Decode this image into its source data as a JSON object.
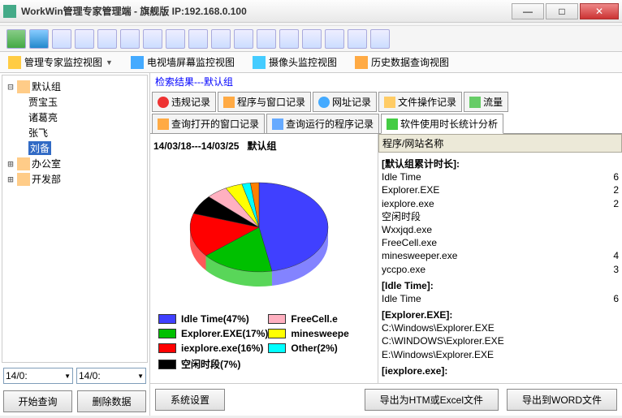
{
  "window": {
    "title": "WorkWin管理专家管理端 - 旗舰版 IP:192.168.0.100"
  },
  "viewtabs": {
    "monitor": "管理专家监控视图",
    "tvwall": "电视墙屏幕监控视图",
    "camera": "摄像头监控视图",
    "history": "历史数据查询视图"
  },
  "tree": {
    "root": "默认组",
    "users": [
      "贾宝玉",
      "诸葛亮",
      "张飞",
      "刘备"
    ],
    "office": "办公室",
    "dev": "开发部"
  },
  "dates": {
    "from": "14/0:",
    "to": "14/0:"
  },
  "buttons": {
    "query": "开始查询",
    "delete": "删除数据",
    "system": "系统设置",
    "export_htm": "导出为HTM或Excel文件",
    "export_word": "导出到WORD文件"
  },
  "search_result": "检索结果---默认组",
  "record_tabs": {
    "violation": "违规记录",
    "program_window": "程序与窗口记录",
    "url": "网址记录",
    "file_op": "文件操作记录",
    "flow": "流量",
    "open_window": "查询打开的窗口记录",
    "running_program": "查询运行的程序记录",
    "usage_stats": "软件使用时长统计分析"
  },
  "chart": {
    "title_range": "14/03/18---14/03/25",
    "title_group": "默认组",
    "legend_left": [
      {
        "label": "Idle Time(47%)",
        "color": "#4040ff"
      },
      {
        "label": "Explorer.EXE(17%)",
        "color": "#00c000"
      },
      {
        "label": "iexplore.exe(16%)",
        "color": "#ff0000"
      },
      {
        "label": "空闲时段(7%)",
        "color": "#000000"
      }
    ],
    "legend_right": [
      {
        "label": "FreeCell.e",
        "color": "#ffb0c0"
      },
      {
        "label": "minesweepe",
        "color": "#ffff00"
      },
      {
        "label": "Other(2%)",
        "color": "#00ffff"
      }
    ]
  },
  "chart_data": {
    "type": "pie",
    "title": "14/03/18---14/03/25 默认组",
    "series": [
      {
        "name": "Idle Time",
        "value": 47,
        "color": "#4040ff"
      },
      {
        "name": "Explorer.EXE",
        "value": 17,
        "color": "#00c000"
      },
      {
        "name": "iexplore.exe",
        "value": 16,
        "color": "#ff0000"
      },
      {
        "name": "空闲时段",
        "value": 7,
        "color": "#000000"
      },
      {
        "name": "FreeCell.exe",
        "value": 5,
        "color": "#ffb0c0"
      },
      {
        "name": "minesweeper.exe",
        "value": 4,
        "color": "#ffff00"
      },
      {
        "name": "Other",
        "value": 2,
        "color": "#00ffff"
      },
      {
        "name": "yccpo.exe",
        "value": 2,
        "color": "#ff8000"
      }
    ]
  },
  "data_list": {
    "header": "程序/网站名称",
    "groups": [
      {
        "title": "[默认组累计时长]:",
        "rows": [
          {
            "name": "Idle Time",
            "val": "6"
          },
          {
            "name": "Explorer.EXE",
            "val": "2"
          },
          {
            "name": "iexplore.exe",
            "val": "2"
          },
          {
            "name": "空闲时段",
            "val": ""
          },
          {
            "name": "Wxxjqd.exe",
            "val": ""
          },
          {
            "name": "FreeCell.exe",
            "val": ""
          },
          {
            "name": "minesweeper.exe",
            "val": "4"
          },
          {
            "name": "yccpo.exe",
            "val": "3"
          }
        ]
      },
      {
        "title": "[Idle Time]:",
        "rows": [
          {
            "name": "Idle Time",
            "val": "6"
          }
        ]
      },
      {
        "title": "[Explorer.EXE]:",
        "rows": [
          {
            "name": "C:\\Windows\\Explorer.EXE",
            "val": ""
          },
          {
            "name": "C:\\WINDOWS\\Explorer.EXE",
            "val": ""
          },
          {
            "name": "E:\\Windows\\Explorer.EXE",
            "val": ""
          }
        ]
      },
      {
        "title": "[iexplore.exe]:",
        "rows": []
      }
    ]
  }
}
